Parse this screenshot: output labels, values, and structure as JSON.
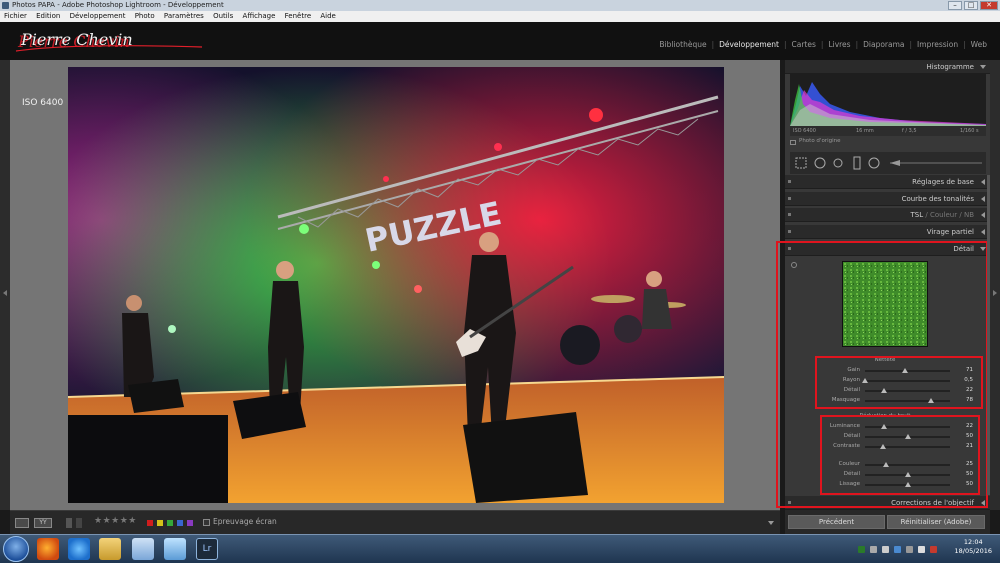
{
  "window": {
    "title": "Photos PAPA - Adobe Photoshop Lightroom - Développement",
    "controls": [
      "minimize",
      "maximize",
      "close"
    ]
  },
  "menu": [
    "Fichier",
    "Edition",
    "Développement",
    "Photo",
    "Paramètres",
    "Outils",
    "Affichage",
    "Fenêtre",
    "Aide"
  ],
  "logo": {
    "text": "Pierre Chevin"
  },
  "modules": {
    "items": [
      "Bibliothèque",
      "Développement",
      "Cartes",
      "Livres",
      "Diaporama",
      "Impression",
      "Web"
    ],
    "active": "Développement"
  },
  "viewer": {
    "overlay_iso": "ISO 6400",
    "photo_text": "PUZZLE"
  },
  "toolbar": {
    "stars": "★★★★★",
    "softproof_label": "Epreuvage écran",
    "color_labels": [
      "#d01d1d",
      "#d4c21a",
      "#35a83a",
      "#3a66d0",
      "#8a3ac0"
    ]
  },
  "panels": {
    "histogram": {
      "title": "Histogramme",
      "iso": "ISO 6400",
      "focal": "16 mm",
      "aperture": "f / 3,5",
      "shutter": "1/160 s",
      "original_photo": "Photo d'origine"
    },
    "basic": {
      "title": "Réglages de base"
    },
    "tone_curve": {
      "title": "Courbe des tonalités"
    },
    "hsl": {
      "title_a": "TSL",
      "sep": "/",
      "title_b": "Couleur",
      "title_c": "NB"
    },
    "split_toning": {
      "title": "Virage partiel"
    },
    "detail": {
      "title": "Détail",
      "sharpening": {
        "title": "Netteté",
        "sliders": [
          {
            "label": "Gain",
            "value": "71",
            "level": 0.47
          },
          {
            "label": "Rayon",
            "value": "0,5",
            "level": 0.0
          },
          {
            "label": "Détail",
            "value": "22",
            "level": 0.22
          },
          {
            "label": "Masquage",
            "value": "78",
            "level": 0.78
          }
        ]
      },
      "noise": {
        "title": "Réduction du bruit",
        "sliders": [
          {
            "label": "Luminance",
            "value": "22",
            "level": 0.22
          },
          {
            "label": "Détail",
            "value": "50",
            "level": 0.5
          },
          {
            "label": "Contraste",
            "value": "21",
            "level": 0.21
          },
          {
            "label": "Couleur",
            "value": "25",
            "level": 0.25
          },
          {
            "label": "Détail",
            "value": "50",
            "level": 0.5
          },
          {
            "label": "Lissage",
            "value": "50",
            "level": 0.5
          }
        ]
      }
    },
    "lens_corrections": {
      "title": "Corrections de l'objectif"
    }
  },
  "buttons": {
    "previous": "Précédent",
    "reset": "Réinitialiser (Adobe)"
  },
  "taskbar": {
    "time": "12:04",
    "date": "18/05/2016",
    "lr_label": "Lr"
  }
}
